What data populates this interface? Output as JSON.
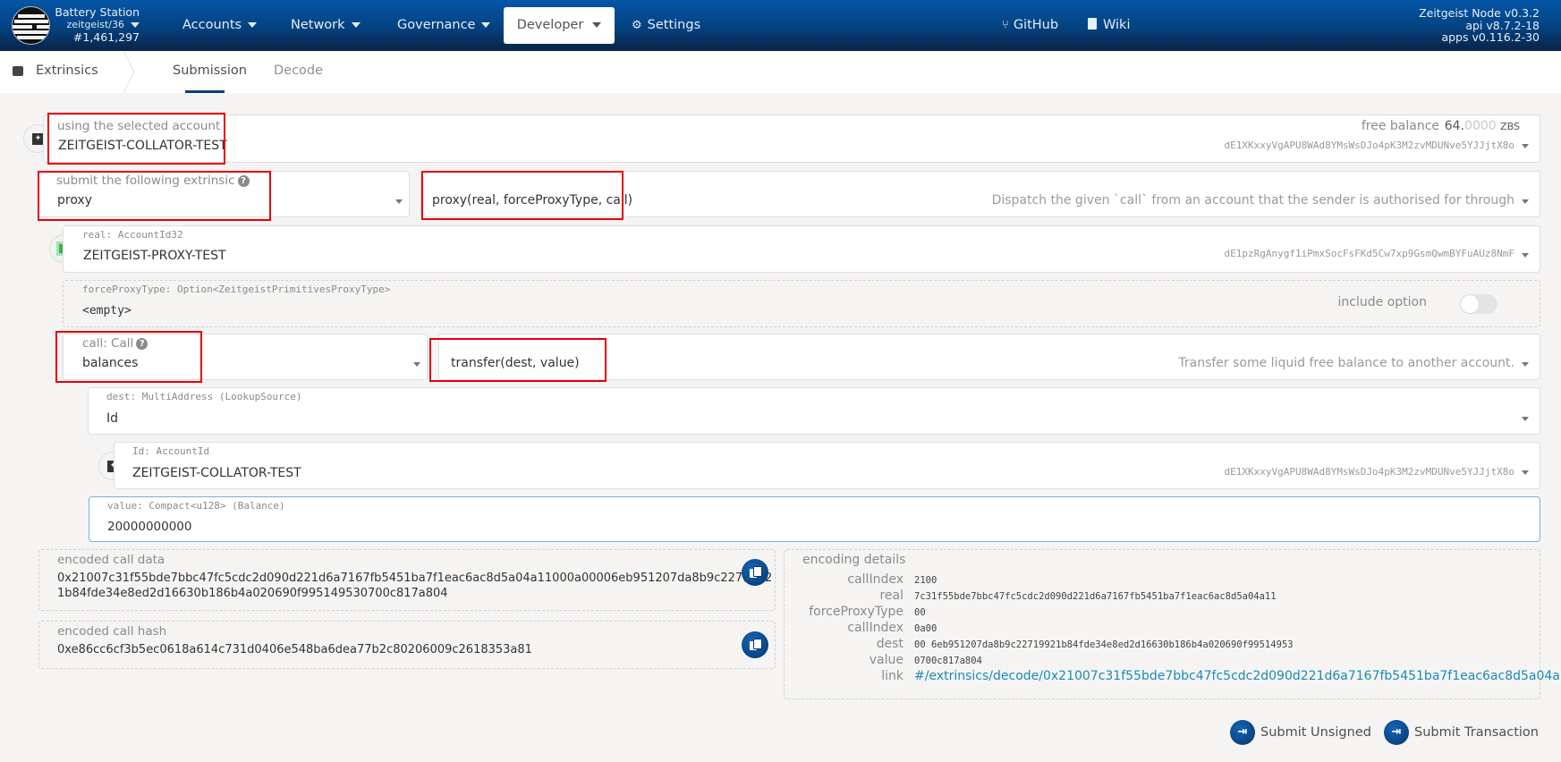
{
  "header": {
    "chain_name": "Battery Station",
    "network": "zeitgeist/36",
    "block": "#1,461,297",
    "nav": [
      {
        "label": "Accounts"
      },
      {
        "label": "Network"
      },
      {
        "label": "Governance"
      },
      {
        "label": "Developer",
        "active": true
      },
      {
        "label": "Settings"
      }
    ],
    "links": [
      {
        "label": "GitHub"
      },
      {
        "label": "Wiki"
      }
    ],
    "version": {
      "node": "Zeitgeist Node v0.3.2",
      "api": "api v8.7.2-18",
      "apps": "apps v0.116.2-30"
    },
    "accent": "#0556a8"
  },
  "tabs": {
    "section": "Extrinsics",
    "items": [
      {
        "label": "Submission",
        "active": true
      },
      {
        "label": "Decode"
      }
    ]
  },
  "form": {
    "account": {
      "label": "using the selected account",
      "name": "ZEITGEIST-COLLATOR-TEST",
      "free_balance_label": "free balance",
      "balance_int": "64.",
      "balance_dec": "0000",
      "balance_unit": "ZBS",
      "address": "dE1XKxxyVgAPU8WAd8YMsWsDJo4pK3M2zvMDUNve5YJJjtX8o"
    },
    "extrinsic": {
      "label": "submit the following extrinsic",
      "module": "proxy",
      "method": "proxy(real, forceProxyType, call)",
      "description": "Dispatch the given `call` from an account that the sender is authorised for through"
    },
    "real": {
      "label": "real: AccountId32",
      "name": "ZEITGEIST-PROXY-TEST",
      "address": "dE1pzRgAnygf1iPmxSocFsFKd5Cw7xp9GsmQwmBYFuAUz8NmF"
    },
    "forceProxyType": {
      "label": "forceProxyType: Option<ZeitgeistPrimitivesProxyType>",
      "value": "<empty>",
      "include_option_label": "include option",
      "include_option": false
    },
    "call": {
      "label": "call: Call",
      "module": "balances",
      "method": "transfer(dest, value)",
      "description": "Transfer some liquid free balance to another account."
    },
    "dest": {
      "label": "dest: MultiAddress (LookupSource)",
      "value": "Id"
    },
    "id": {
      "label": "Id: AccountId",
      "name": "ZEITGEIST-COLLATOR-TEST",
      "address": "dE1XKxxyVgAPU8WAd8YMsWsDJo4pK3M2zvMDUNve5YJJjtX8o"
    },
    "value": {
      "label": "value: Compact<u128> (Balance)",
      "value": "20000000000"
    }
  },
  "encoded": {
    "call_data_label": "encoded call data",
    "call_data_line1": "0x21007c31f55bde7bbc47fc5cdc2d090d221d6a7167fb5451ba7f1eac6ac8d5a04a11000a00006eb951207da8b9c2271992",
    "call_data_line2": "1b84fde34e8ed2d16630b186b4a020690f995149530700c817a804",
    "call_hash_label": "encoded call hash",
    "call_hash": "0xe86cc6cf3b5ec0618a614c731d0406e548ba6dea77b2c80206009c2618353a81"
  },
  "encoding_details": {
    "title": "encoding details",
    "rows": [
      {
        "key": "callIndex",
        "value": "2100"
      },
      {
        "key": "real",
        "value": "7c31f55bde7bbc47fc5cdc2d090d221d6a7167fb5451ba7f1eac6ac8d5a04a11"
      },
      {
        "key": "forceProxyType",
        "value": "00"
      },
      {
        "key": "callIndex",
        "value": "0a00"
      },
      {
        "key": "dest",
        "value": "00 6eb951207da8b9c22719921b84fde34e8ed2d16630b186b4a020690f99514953"
      },
      {
        "key": "value",
        "value": "0700c817a804"
      },
      {
        "key": "link",
        "value": "#/extrinsics/decode/0x21007c31f55bde7bbc47fc5cdc2d090d221d6a7167fb5451ba7f1eac6ac8d5a04a..."
      }
    ]
  },
  "actions": {
    "submit_unsigned": "Submit Unsigned",
    "submit_transaction": "Submit Transaction"
  }
}
